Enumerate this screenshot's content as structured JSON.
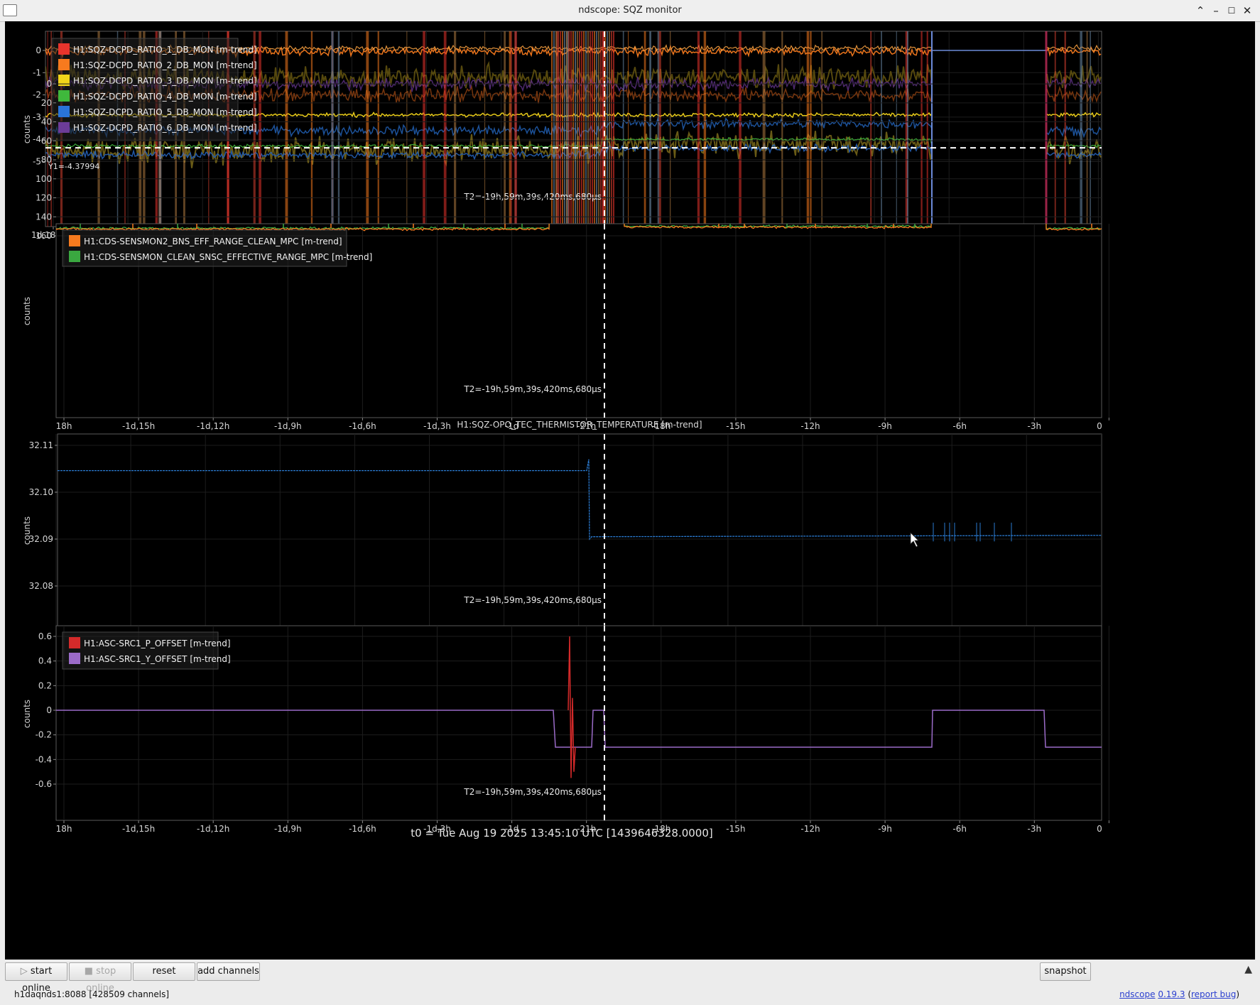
{
  "window": {
    "title": "ndscope: SQZ monitor"
  },
  "plots": [
    {
      "id": "p1",
      "ylabel": "counts",
      "yticks": [
        {
          "v": 0,
          "t": "0"
        },
        {
          "v": -1,
          "t": "-1"
        },
        {
          "v": -2,
          "t": "-2"
        },
        {
          "v": -3,
          "t": "-3"
        },
        {
          "v": -4,
          "t": "-4"
        },
        {
          "v": -5,
          "t": "-5"
        }
      ],
      "xticks": [
        "1d,18h",
        "-1d,15h",
        "-1d,12h",
        "-1d,9h",
        "-1d,6h",
        "-1d,3h",
        "-1d",
        "-21h",
        "-18h",
        "-15h",
        "-12h",
        "-9h",
        "-6h",
        "-3h",
        "0"
      ],
      "legend": [
        {
          "label": "H1:SQZ-DCPD_RATIO_1_DB_MON [m-trend]",
          "color": "#e8342c"
        },
        {
          "label": "H1:SQZ-DCPD_RATIO_2_DB_MON [m-trend]",
          "color": "#f77a1e"
        },
        {
          "label": "H1:SQZ-DCPD_RATIO_3_DB_MON [m-trend]",
          "color": "#f2d41a"
        },
        {
          "label": "H1:SQZ-DCPD_RATIO_4_DB_MON [m-trend]",
          "color": "#3fb83c"
        },
        {
          "label": "H1:SQZ-DCPD_RATIO_5_DB_MON [m-trend]",
          "color": "#2a74d9"
        },
        {
          "label": "H1:SQZ-DCPD_RATIO_6_DB_MON [m-trend]",
          "color": "#6c3c98"
        }
      ],
      "y_cursor_label": "Y1=-4.37994",
      "y_cursor_value": -4.37994,
      "t_cursor_label": "T2=-19h,59m,39s,420ms,680µs"
    },
    {
      "id": "p2",
      "ylabel": "counts",
      "yticks": [
        {
          "v": 160,
          "t": "160"
        },
        {
          "v": 140,
          "t": "140"
        },
        {
          "v": 120,
          "t": "120"
        },
        {
          "v": 100,
          "t": "100"
        },
        {
          "v": 80,
          "t": "80"
        },
        {
          "v": 60,
          "t": "60"
        },
        {
          "v": 40,
          "t": "40"
        },
        {
          "v": 20,
          "t": "20"
        },
        {
          "v": 0,
          "t": "0"
        }
      ],
      "xticks": [
        "18h",
        "-1d,15h",
        "-1d,12h",
        "-1d,9h",
        "-1d,6h",
        "-1d,3h",
        "-1d",
        "-21h",
        "-18h",
        "-15h",
        "-12h",
        "-9h",
        "-6h",
        "-3h",
        "0"
      ],
      "legend": [
        {
          "label": "H1:CDS-SENSMON2_BNS_EFF_RANGE_CLEAN_MPC [m-trend]",
          "color": "#f77a1e"
        },
        {
          "label": "H1:CDS-SENSMON_CLEAN_SNSC_EFFECTIVE_RANGE_MPC [m-trend]",
          "color": "#3aa840"
        }
      ],
      "t_cursor_label": "T2=-19h,59m,39s,420ms,680µs"
    },
    {
      "id": "p3",
      "title": "H1:SQZ-OPO_TEC_THERMISTOR_TEMPERATURE [m-trend]",
      "ylabel": "counts",
      "yticks": [
        {
          "v": 32.11,
          "t": "32.11"
        },
        {
          "v": 32.1,
          "t": "32.10"
        },
        {
          "v": 32.09,
          "t": "32.09"
        },
        {
          "v": 32.08,
          "t": "32.08"
        }
      ],
      "xticks": [
        "",
        "-1d,15h",
        "-1d,12h",
        "-1d,9h",
        "-1d,6h",
        "-1d,3h",
        "-1d",
        "-21h",
        "-18h",
        "-15h",
        "-12h",
        "-9h",
        "-6h",
        "-3h",
        "0"
      ],
      "t_cursor_label": "T2=-19h,59m,39s,420ms,680µs"
    },
    {
      "id": "p4",
      "ylabel": "counts",
      "yticks": [
        {
          "v": 0.6,
          "t": "0.6"
        },
        {
          "v": 0.4,
          "t": "0.4"
        },
        {
          "v": 0.2,
          "t": "0.2"
        },
        {
          "v": 0,
          "t": "0"
        },
        {
          "v": -0.2,
          "t": "-0.2"
        },
        {
          "v": -0.4,
          "t": "-0.4"
        },
        {
          "v": -0.6,
          "t": "-0.6"
        }
      ],
      "xticks": [
        "18h",
        "-1d,15h",
        "-1d,12h",
        "-1d,9h",
        "-1d,6h",
        "-1d,3h",
        "-1d",
        "-21h",
        "-18h",
        "-15h",
        "-12h",
        "-9h",
        "-6h",
        "-3h",
        "0"
      ],
      "legend": [
        {
          "label": "H1:ASC-SRC1_P_OFFSET [m-trend]",
          "color": "#d42a2a"
        },
        {
          "label": "H1:ASC-SRC1_Y_OFFSET [m-trend]",
          "color": "#9b6bc8"
        }
      ],
      "t_cursor_label": "T2=-19h,59m,39s,420ms,680µs"
    }
  ],
  "t0_label": "t0 = Tue Aug 19 2025 13:45:10 UTC [1439646328.0000]",
  "footer": {
    "start_online": "start online",
    "stop_online": "stop online",
    "reset": "reset",
    "add_channels": "add channels",
    "snapshot": "snapshot",
    "server": "h1daqnds1:8088  [428509 channels]",
    "version_name": "ndscope",
    "version_num": "0.19.3",
    "report_bug": "report bug"
  }
}
